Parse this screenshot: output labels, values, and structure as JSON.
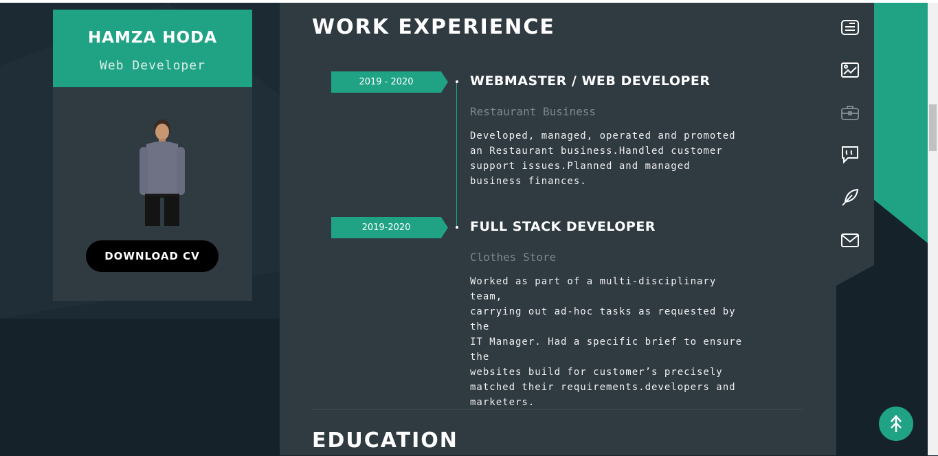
{
  "profile": {
    "name": "HAMZA HODA",
    "role": "Web Developer",
    "download_label": "DOWNLOAD CV"
  },
  "work": {
    "section_title": "WORK EXPERIENCE",
    "items": [
      {
        "date": "2019 - 2020",
        "title": "WEBMASTER / WEB DEVELOPER",
        "company": "Restaurant Business",
        "desc_lines": [
          "Developed, managed, operated and promoted",
          "an Restaurant business.Handled customer",
          "support issues.Planned and managed",
          "business finances."
        ]
      },
      {
        "date": "2019-2020",
        "title": "FULL STACK DEVELOPER",
        "company": "Clothes Store",
        "desc_lines": [
          "Worked as part of a multi-disciplinary team,",
          "carrying out ad-hoc tasks as requested by the",
          "IT Manager. Had a specific brief to ensure the",
          "websites build for customer’s precisely",
          "matched their requirements.developers and",
          "marketers."
        ]
      }
    ]
  },
  "education": {
    "section_title": "EDUCATION"
  },
  "nav_icons": [
    "resume-icon",
    "portfolio-icon",
    "briefcase-icon",
    "testimonial-quote-icon",
    "blog-feather-icon",
    "mail-icon"
  ],
  "colors": {
    "accent": "#20a384",
    "panel": "#2f3a41",
    "background": "#16222a"
  }
}
